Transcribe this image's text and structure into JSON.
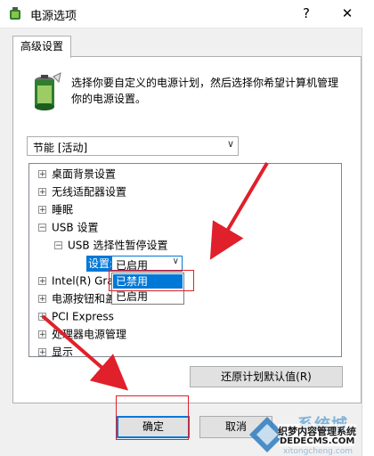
{
  "window": {
    "title": "电源选项",
    "help_glyph": "?",
    "close_glyph": "✕"
  },
  "tabs": [
    {
      "label": "高级设置"
    }
  ],
  "description": "选择你要自定义的电源计划，然后选择你希望计算机管理你的电源设置。",
  "plan_select": {
    "value": "节能 [活动]"
  },
  "tree": {
    "items": [
      {
        "expander": "+",
        "label": "桌面背景设置"
      },
      {
        "expander": "+",
        "label": "无线适配器设置"
      },
      {
        "expander": "+",
        "label": "睡眠"
      },
      {
        "expander": "−",
        "label": "USB 设置"
      },
      {
        "expander": "−",
        "label": "USB 选择性暂停设置"
      },
      {
        "expander": "+",
        "label": "Intel(R) Gra"
      },
      {
        "expander": "+",
        "label": "电源按钮和盖"
      },
      {
        "expander": "+",
        "label": "PCI Express"
      },
      {
        "expander": "+",
        "label": "处理器电源管理"
      },
      {
        "expander": "+",
        "label": "显示"
      }
    ],
    "setting_label": "设置:",
    "setting_value": "已启用",
    "options": [
      "已禁用",
      "已启用"
    ]
  },
  "buttons": {
    "restore_defaults": "还原计划默认值(R)",
    "ok": "确定",
    "cancel": "取消"
  },
  "watermark": {
    "logo_text": "系统城",
    "line1": "织梦内容管理系统",
    "line2": "DEDECMS.COM",
    "line3": "xitongcheng.com"
  },
  "colors": {
    "accent": "#0078d7",
    "annotation": "#e0202a",
    "window_bg": "#f0f0f0"
  }
}
